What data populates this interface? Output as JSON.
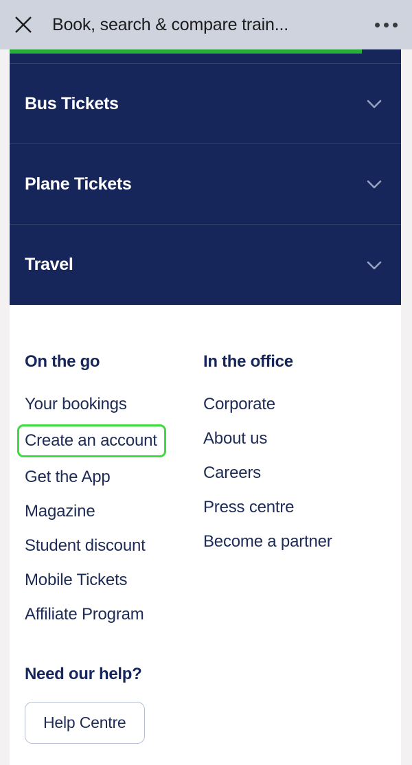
{
  "browser_chrome": {
    "close_icon": "close-x-icon",
    "title": "Book, search & compare train...",
    "overflow_icon": "more-horizontal-icon"
  },
  "progress": {
    "percent": 90,
    "fill_color": "#27ae37",
    "track_color": "#16265a"
  },
  "theme": {
    "navy": "#16265a",
    "green_highlight": "#3ddb3d",
    "page_background": "#f4f1f2",
    "chrome_background": "#ced3dd"
  },
  "accordion": {
    "chevron_icon": "chevron-down-icon",
    "items": [
      {
        "label": "Bus Tickets"
      },
      {
        "label": "Plane Tickets"
      },
      {
        "label": "Travel"
      }
    ]
  },
  "footer": {
    "columns": [
      {
        "heading": "On the go",
        "links": [
          {
            "label": "Your bookings",
            "highlighted": false
          },
          {
            "label": "Create an account",
            "highlighted": true
          },
          {
            "label": "Get the App",
            "highlighted": false
          },
          {
            "label": "Magazine",
            "highlighted": false
          },
          {
            "label": "Student discount",
            "highlighted": false
          },
          {
            "label": "Mobile Tickets",
            "highlighted": false
          },
          {
            "label": "Affiliate Program",
            "highlighted": false
          }
        ]
      },
      {
        "heading": "In the office",
        "links": [
          {
            "label": "Corporate",
            "highlighted": false
          },
          {
            "label": "About us",
            "highlighted": false
          },
          {
            "label": "Careers",
            "highlighted": false
          },
          {
            "label": "Press centre",
            "highlighted": false
          },
          {
            "label": "Become a partner",
            "highlighted": false
          }
        ]
      }
    ],
    "help": {
      "heading": "Need our help?",
      "button_label": "Help Centre"
    }
  }
}
